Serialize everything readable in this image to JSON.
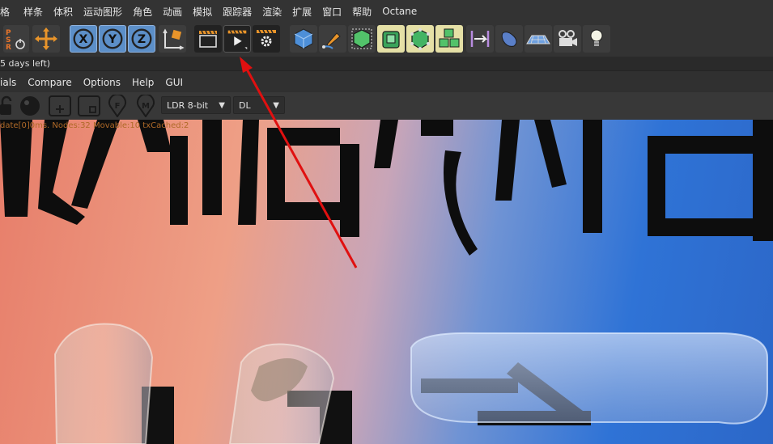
{
  "menubar": {
    "items": [
      "格",
      "样条",
      "体积",
      "运动图形",
      "角色",
      "动画",
      "模拟",
      "跟踪器",
      "渲染",
      "扩展",
      "窗口",
      "帮助",
      "Octane"
    ]
  },
  "toolbar": {
    "icons": [
      "psr-reset-icon",
      "move-icon",
      "x-axis-lock-icon",
      "y-axis-lock-icon",
      "z-axis-lock-icon",
      "coordinate-system-icon",
      "render-region-icon",
      "render-view-icon",
      "render-settings-icon",
      "cube-icon",
      "pen-icon",
      "subdivision-icon",
      "extrude-icon",
      "cloner-icon",
      "array-icon",
      "deformer-icon",
      "sphere-icon",
      "floor-icon",
      "camera-icon",
      "light-icon"
    ]
  },
  "trial": {
    "text": "5 days left)"
  },
  "window_menu": {
    "items": [
      "ials",
      "Compare",
      "Options",
      "Help",
      "GUI"
    ]
  },
  "window_tools": {
    "color_mode": "LDR 8-bit",
    "kernel": "DL"
  },
  "render_status": {
    "text": "date[0]0ms. Nodes:32 Movable:10 txCached:2"
  },
  "colors": {
    "accent_blue": "#5c8fc8",
    "highlight_yellow": "#e5e0a6",
    "arrow_red": "#e01010",
    "status_orange": "#b06a28"
  }
}
